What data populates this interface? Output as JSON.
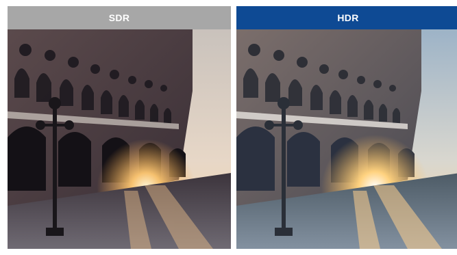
{
  "comparison": {
    "left": {
      "label": "SDR",
      "header_color": "#a7a7a7"
    },
    "right": {
      "label": "HDR",
      "header_color": "#0e4a94"
    }
  },
  "image": {
    "subject": "palace-arcade-at-sunset"
  }
}
